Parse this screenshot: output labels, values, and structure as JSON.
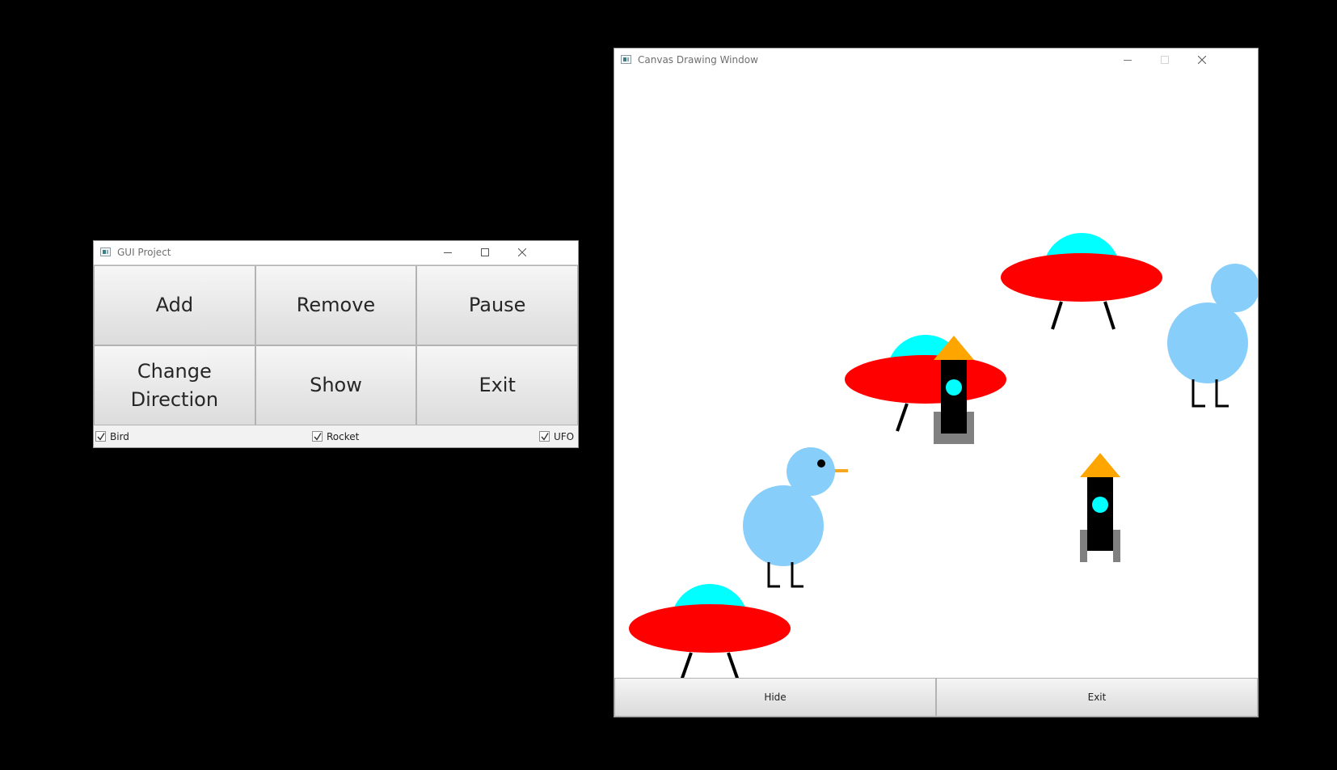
{
  "gui_window": {
    "title": "GUI Project",
    "buttons": {
      "add": "Add",
      "remove": "Remove",
      "pause": "Pause",
      "change_direction": "Change Direction",
      "show": "Show",
      "exit": "Exit"
    },
    "checkboxes": [
      {
        "label": "Bird",
        "checked": true
      },
      {
        "label": "Rocket",
        "checked": true
      },
      {
        "label": "UFO",
        "checked": true
      }
    ]
  },
  "canvas_window": {
    "title": "Canvas Drawing Window",
    "buttons": {
      "hide": "Hide",
      "exit": "Exit"
    }
  },
  "colors": {
    "ufo_dome": "#00ffff",
    "ufo_body": "#ff0000",
    "bird_body": "#87cefa",
    "bird_beak": "#f5a623",
    "rocket_nose": "#ffa500",
    "rocket_body": "#000000",
    "rocket_window": "#00ffff",
    "rocket_fins": "#808080"
  }
}
